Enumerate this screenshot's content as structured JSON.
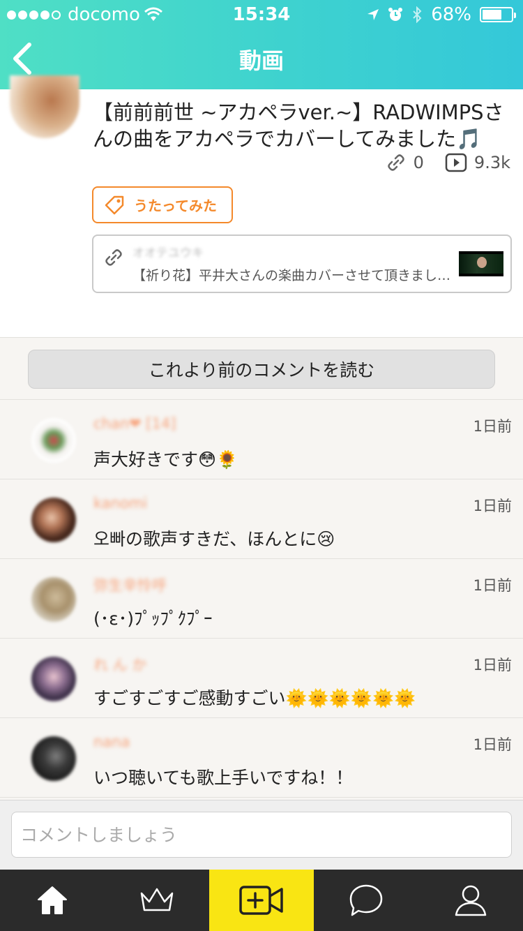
{
  "status_bar": {
    "carrier": "docomo",
    "time": "15:34",
    "battery_percent": "68%",
    "battery_level": 0.68,
    "signal_bars_filled": 4,
    "signal_bars_total": 5
  },
  "nav": {
    "title": "動画"
  },
  "post": {
    "title": "【前前前世 ~アカペラver.~】RADWIMPSさんの曲をアカペラでカバーしてみました🎵",
    "share_count": "0",
    "play_count": "9.3k",
    "tag": "うたってみた",
    "link": {
      "author": "オオテユウキ",
      "text": "【祈り花】平井大さんの楽曲カバーさせて頂きました..."
    }
  },
  "load_more_label": "これより前のコメントを読む",
  "comments": [
    {
      "name": "chan❤ [14]",
      "time": "1日前",
      "text": "声大好きです😳🌻"
    },
    {
      "name": "kanomi",
      "time": "1日前",
      "text": "오빠の歌声すきだ、ほんとに😢"
    },
    {
      "name": "弥生辛怜呼",
      "time": "1日前",
      "text": "(･ε･)ﾌﾟｯﾌﾟｸﾌﾟｰ"
    },
    {
      "name": "れ ん か",
      "time": "1日前",
      "text": "すごすごすご感動すごい🌞🌞🌞🌞🌞🌞"
    },
    {
      "name": "nana",
      "time": "1日前",
      "text": "いつ聴いても歌上手いですね！！"
    }
  ],
  "comment_input": {
    "placeholder": "コメントしましょう"
  },
  "tabs": [
    {
      "icon": "home-icon"
    },
    {
      "icon": "crown-icon"
    },
    {
      "icon": "video-plus-icon"
    },
    {
      "icon": "chat-bubble-icon"
    },
    {
      "icon": "profile-icon"
    }
  ],
  "colors": {
    "header_start": "#4fdfc5",
    "header_end": "#34c8d9",
    "tag_accent": "#f4892b",
    "tab_active": "#f9e513",
    "tab_bar": "#2b2b2b"
  }
}
